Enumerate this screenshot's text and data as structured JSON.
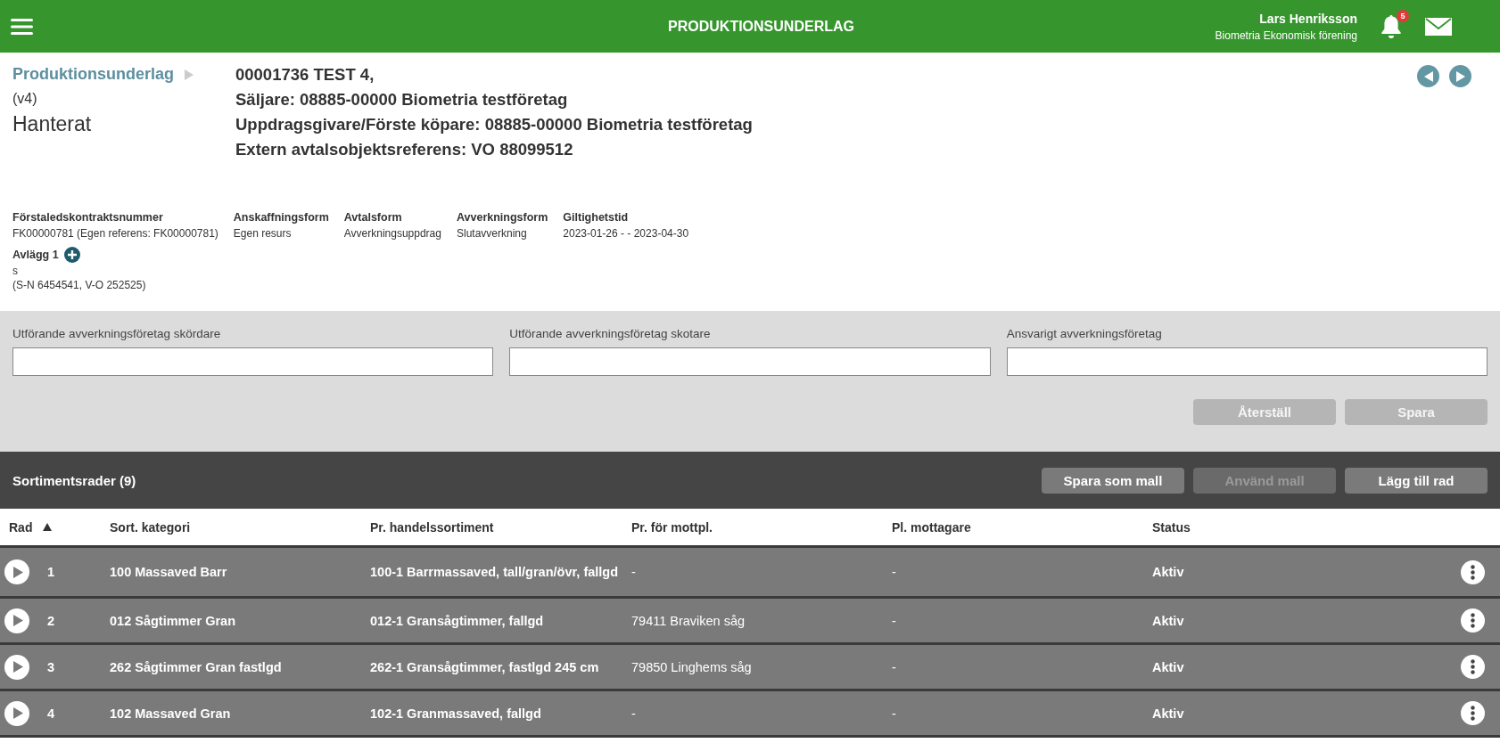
{
  "header": {
    "title": "PRODUKTIONSUNDERLAG",
    "user_name": "Lars Henriksson",
    "organization": "Biometria Ekonomisk förening",
    "notification_count": "5"
  },
  "breadcrumb": {
    "link": "Produktionsunderlag",
    "version": "(v4)",
    "status": "Hanterat"
  },
  "title_lines": [
    "00001736 TEST 4,",
    "Säljare: 08885-00000 Biometria testföretag",
    "Uppdragsgivare/Förste köpare: 08885-00000 Biometria testföretag",
    "Extern avtalsobjektsreferens: VO 88099512"
  ],
  "details": [
    {
      "label": "Förstaledskontraktsnummer",
      "value": "FK00000781 (Egen referens: FK00000781)"
    },
    {
      "label": "Anskaffningsform",
      "value": "Egen resurs"
    },
    {
      "label": "Avtalsform",
      "value": "Avverkningsuppdrag"
    },
    {
      "label": "Avverkningsform",
      "value": "Slutavverkning"
    },
    {
      "label": "Giltighetstid",
      "value": "2023-01-26 - - 2023-04-30"
    }
  ],
  "landing": {
    "label": "Avlägg 1",
    "lines": [
      "s",
      "(S-N 6454541, V-O 252525)"
    ]
  },
  "form_fields": [
    {
      "label": "Utförande avverkningsföretag skördare"
    },
    {
      "label": "Utförande avverkningsföretag skotare"
    },
    {
      "label": "Ansvarigt avverkningsföretag"
    }
  ],
  "form_buttons": [
    {
      "label": "Återställ",
      "disabled": true
    },
    {
      "label": "Spara",
      "disabled": true
    }
  ],
  "section": {
    "title": "Sortimentsrader (9)",
    "buttons": [
      {
        "label": "Spara som mall",
        "disabled": false
      },
      {
        "label": "Använd mall",
        "disabled": true
      },
      {
        "label": "Lägg till rad",
        "disabled": false
      }
    ]
  },
  "table": {
    "columns": [
      "Rad",
      "Sort. kategori",
      "Pr. handelssortiment",
      "Pr. för mottpl.",
      "Pl. mottagare",
      "Status"
    ],
    "rows": [
      {
        "rad": "1",
        "category": "100 Massaved Barr",
        "assortment": "100-1 Barrmassaved, tall/gran/övr, fallgd",
        "receiving_place": "-",
        "receiver": "-",
        "status": "Aktiv"
      },
      {
        "rad": "2",
        "category": "012 Sågtimmer Gran",
        "assortment": "012-1 Gransågtimmer, fallgd",
        "receiving_place": "79411 Braviken såg",
        "receiver": "-",
        "status": "Aktiv"
      },
      {
        "rad": "3",
        "category": "262 Sågtimmer Gran fastlgd",
        "assortment": "262-1 Gransågtimmer, fastlgd 245 cm",
        "receiving_place": "79850 Linghems såg",
        "receiver": "-",
        "status": "Aktiv"
      },
      {
        "rad": "4",
        "category": "102 Massaved Gran",
        "assortment": "102-1 Granmassaved, fallgd",
        "receiving_place": "-",
        "receiver": "-",
        "status": "Aktiv"
      }
    ]
  }
}
